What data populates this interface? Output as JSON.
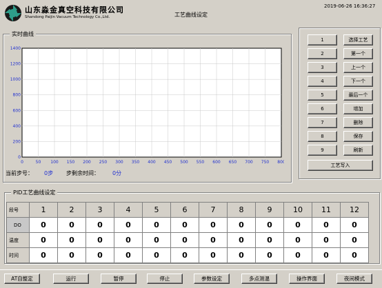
{
  "header": {
    "company_cn": "山东淼金真空科技有限公司",
    "company_en": "Shandong Paijin Vacuum Technology Co.,Ltd.",
    "page_title": "工艺曲线设定",
    "datetime": "2019-06-26 16:36:27"
  },
  "chart_section": {
    "title": "实时曲线",
    "current_step_label": "当前步号：",
    "current_step_value": "0步",
    "remaining_time_label": "步剩余时间：",
    "remaining_time_value": "0分"
  },
  "chart_data": {
    "type": "line",
    "title": "实时曲线",
    "xlabel": "",
    "ylabel": "",
    "xlim": [
      0,
      800
    ],
    "ylim": [
      0,
      1400
    ],
    "x_ticks": [
      0,
      50,
      100,
      150,
      200,
      250,
      300,
      350,
      400,
      450,
      500,
      550,
      600,
      650,
      700,
      750,
      800
    ],
    "y_ticks": [
      0,
      200,
      400,
      600,
      800,
      1000,
      1200,
      1400
    ],
    "grid": true,
    "series": [],
    "colors": {
      "axis_text": "#2030d0",
      "plot_bg": "#ffffff",
      "grid": "#c8c8c8"
    }
  },
  "right_panel": {
    "step_buttons": [
      "1",
      "2",
      "3",
      "4",
      "5",
      "6",
      "7",
      "8",
      "9"
    ],
    "action_buttons": [
      "选择工艺",
      "第一个",
      "上一个",
      "下一个",
      "最后一个",
      "增加",
      "删除",
      "保存",
      "刷新"
    ],
    "write_button": "工艺写入"
  },
  "pid_section": {
    "title": "PID工艺曲线设定",
    "header_label": "段号",
    "columns": [
      "1",
      "2",
      "3",
      "4",
      "5",
      "6",
      "7",
      "8",
      "9",
      "10",
      "11",
      "12"
    ],
    "rows": [
      {
        "label": "DO",
        "values": [
          "0",
          "0",
          "0",
          "0",
          "0",
          "0",
          "0",
          "0",
          "0",
          "0",
          "0",
          "0"
        ]
      },
      {
        "label": "温度",
        "values": [
          "0",
          "0",
          "0",
          "0",
          "0",
          "0",
          "0",
          "0",
          "0",
          "0",
          "0",
          "0"
        ]
      },
      {
        "label": "时间",
        "values": [
          "0",
          "0",
          "0",
          "0",
          "0",
          "0",
          "0",
          "0",
          "0",
          "0",
          "0",
          "0"
        ]
      }
    ]
  },
  "bottom_bar": {
    "buttons": [
      "AT自整定",
      "运行",
      "暂停",
      "停止",
      "参数设定",
      "多点测温",
      "操作界面",
      "夜间模式"
    ]
  }
}
